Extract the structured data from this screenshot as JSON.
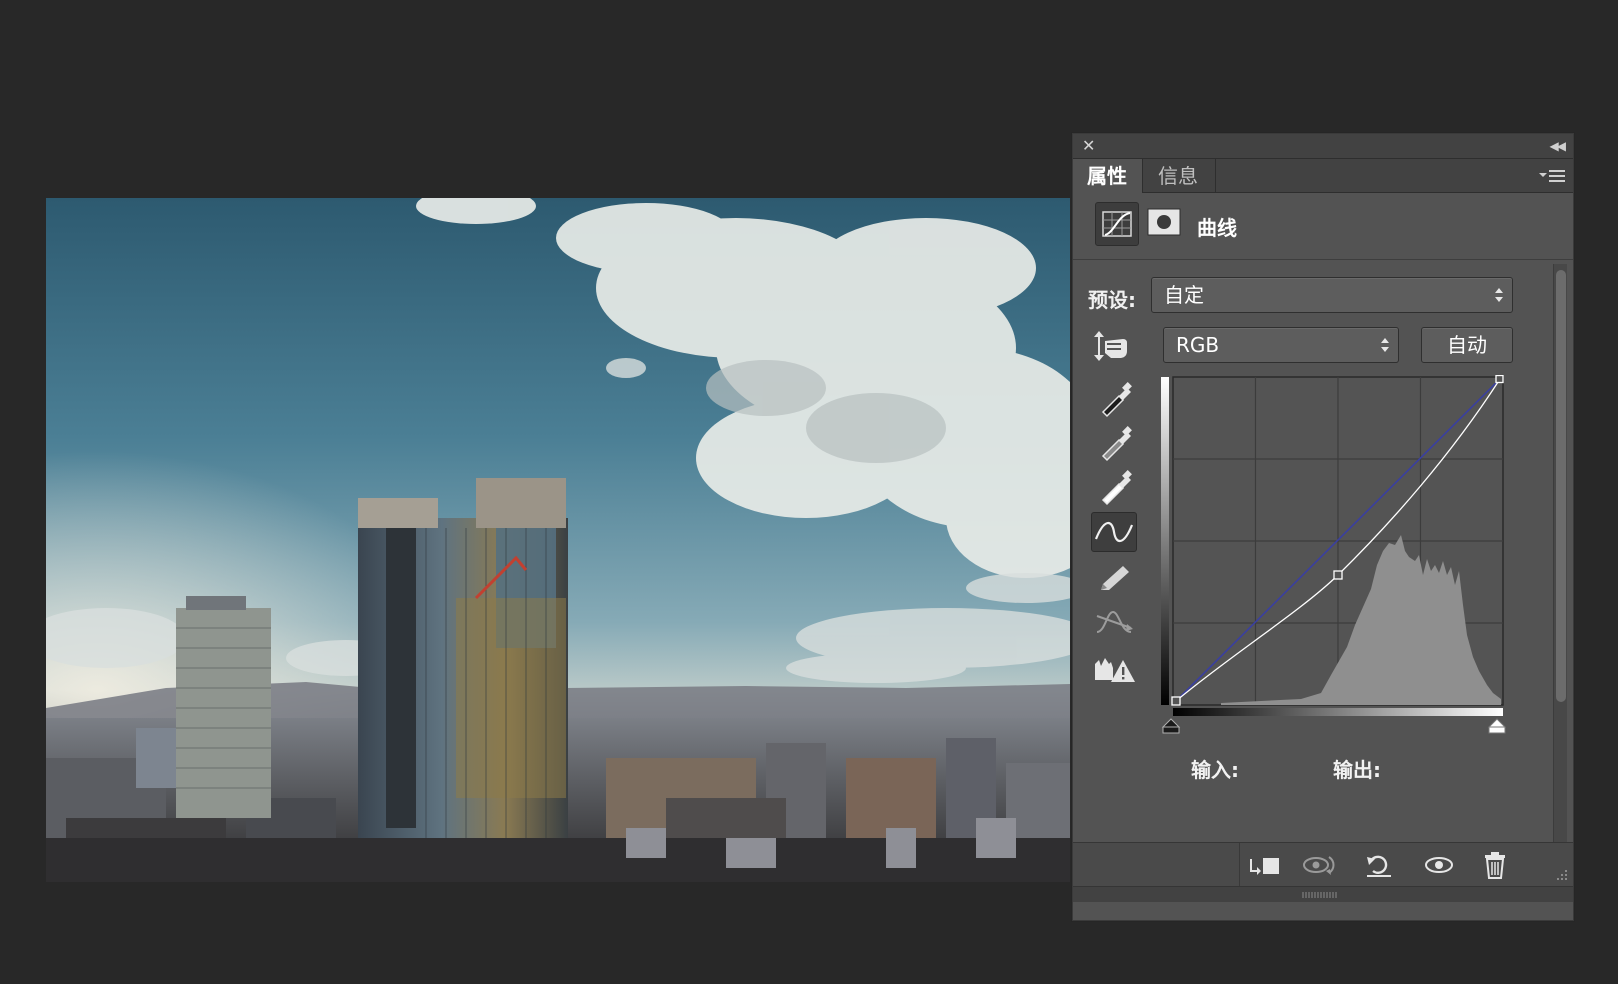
{
  "panel": {
    "tabs": [
      {
        "label": "属性",
        "active": true
      },
      {
        "label": "信息",
        "active": false
      }
    ],
    "adjustment_title": "曲线",
    "preset_label": "预设:",
    "preset_value": "自定",
    "channel_value": "RGB",
    "auto_label": "自动",
    "input_label": "输入:",
    "output_label": "输出:"
  },
  "icons": {
    "close": "close-icon",
    "collapse": "double-chevron-left-icon",
    "panel_menu": "panel-menu-icon",
    "curves_adjustment": "curves-adjustment-icon",
    "layer_mask": "layer-mask-icon",
    "target_adjust": "on-image-adjust-hand-icon",
    "eyedroppers": [
      "black-point-eyedropper-icon",
      "gray-point-eyedropper-icon",
      "white-point-eyedropper-icon"
    ],
    "curve_points": "edit-points-curve-icon",
    "pencil": "draw-curve-pencil-icon",
    "smooth": "smooth-curve-icon",
    "clipping_warning": "clipping-warning-icon",
    "bottom": [
      "clip-to-layer-icon",
      "view-previous-state-icon",
      "reset-icon",
      "toggle-visibility-icon",
      "delete-icon"
    ]
  },
  "colors": {
    "panel_bg": "#535353",
    "panel_dark": "#424242",
    "app_bg": "#282828",
    "curve": "#ffffff",
    "baseline": "#3a3fa0"
  }
}
